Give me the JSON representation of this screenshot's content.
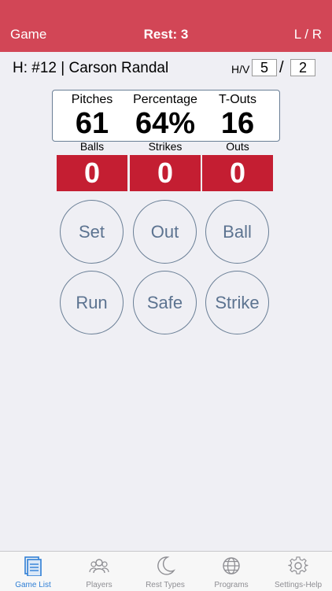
{
  "navbar": {
    "left_label": "Game",
    "title": "Rest: 3",
    "right_label": "L / R"
  },
  "hitter": {
    "label": "H: #12 | Carson Randal",
    "hv_label": "H/V",
    "home": "5",
    "separator": "/",
    "visitor": "2"
  },
  "stats": [
    {
      "label": "Pitches",
      "value": "61"
    },
    {
      "label": "Percentage",
      "value": "64%"
    },
    {
      "label": "T-Outs",
      "value": "16"
    }
  ],
  "counts": [
    {
      "label": "Balls",
      "value": "0"
    },
    {
      "label": "Strikes",
      "value": "0"
    },
    {
      "label": "Outs",
      "value": "0"
    }
  ],
  "actions": {
    "set": "Set",
    "out": "Out",
    "ball": "Ball",
    "run": "Run",
    "safe": "Safe",
    "strike": "Strike"
  },
  "tabs": [
    {
      "label": "Game List",
      "icon": "game-list-icon",
      "active": true
    },
    {
      "label": "Players",
      "icon": "players-icon",
      "active": false
    },
    {
      "label": "Rest Types",
      "icon": "moon-icon",
      "active": false
    },
    {
      "label": "Programs",
      "icon": "globe-icon",
      "active": false
    },
    {
      "label": "Settings-Help",
      "icon": "gear-icon",
      "active": false
    }
  ],
  "colors": {
    "navbar": "#d24656",
    "count_box": "#c41e32",
    "button_text": "#5c7390",
    "tab_active": "#2f7fd6",
    "tab_inactive": "#8e8e93"
  }
}
